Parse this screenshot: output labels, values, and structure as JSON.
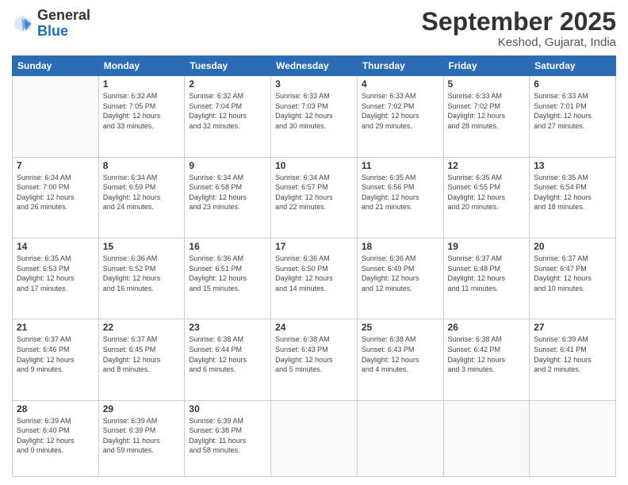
{
  "logo": {
    "general": "General",
    "blue": "Blue"
  },
  "header": {
    "month": "September 2025",
    "location": "Keshod, Gujarat, India"
  },
  "weekdays": [
    "Sunday",
    "Monday",
    "Tuesday",
    "Wednesday",
    "Thursday",
    "Friday",
    "Saturday"
  ],
  "weeks": [
    [
      {
        "day": "",
        "info": ""
      },
      {
        "day": "1",
        "info": "Sunrise: 6:32 AM\nSunset: 7:05 PM\nDaylight: 12 hours\nand 33 minutes."
      },
      {
        "day": "2",
        "info": "Sunrise: 6:32 AM\nSunset: 7:04 PM\nDaylight: 12 hours\nand 32 minutes."
      },
      {
        "day": "3",
        "info": "Sunrise: 6:33 AM\nSunset: 7:03 PM\nDaylight: 12 hours\nand 30 minutes."
      },
      {
        "day": "4",
        "info": "Sunrise: 6:33 AM\nSunset: 7:02 PM\nDaylight: 12 hours\nand 29 minutes."
      },
      {
        "day": "5",
        "info": "Sunrise: 6:33 AM\nSunset: 7:02 PM\nDaylight: 12 hours\nand 28 minutes."
      },
      {
        "day": "6",
        "info": "Sunrise: 6:33 AM\nSunset: 7:01 PM\nDaylight: 12 hours\nand 27 minutes."
      }
    ],
    [
      {
        "day": "7",
        "info": "Sunrise: 6:34 AM\nSunset: 7:00 PM\nDaylight: 12 hours\nand 26 minutes."
      },
      {
        "day": "8",
        "info": "Sunrise: 6:34 AM\nSunset: 6:59 PM\nDaylight: 12 hours\nand 24 minutes."
      },
      {
        "day": "9",
        "info": "Sunrise: 6:34 AM\nSunset: 6:58 PM\nDaylight: 12 hours\nand 23 minutes."
      },
      {
        "day": "10",
        "info": "Sunrise: 6:34 AM\nSunset: 6:57 PM\nDaylight: 12 hours\nand 22 minutes."
      },
      {
        "day": "11",
        "info": "Sunrise: 6:35 AM\nSunset: 6:56 PM\nDaylight: 12 hours\nand 21 minutes."
      },
      {
        "day": "12",
        "info": "Sunrise: 6:35 AM\nSunset: 6:55 PM\nDaylight: 12 hours\nand 20 minutes."
      },
      {
        "day": "13",
        "info": "Sunrise: 6:35 AM\nSunset: 6:54 PM\nDaylight: 12 hours\nand 18 minutes."
      }
    ],
    [
      {
        "day": "14",
        "info": "Sunrise: 6:35 AM\nSunset: 6:53 PM\nDaylight: 12 hours\nand 17 minutes."
      },
      {
        "day": "15",
        "info": "Sunrise: 6:36 AM\nSunset: 6:52 PM\nDaylight: 12 hours\nand 16 minutes."
      },
      {
        "day": "16",
        "info": "Sunrise: 6:36 AM\nSunset: 6:51 PM\nDaylight: 12 hours\nand 15 minutes."
      },
      {
        "day": "17",
        "info": "Sunrise: 6:36 AM\nSunset: 6:50 PM\nDaylight: 12 hours\nand 14 minutes."
      },
      {
        "day": "18",
        "info": "Sunrise: 6:36 AM\nSunset: 6:49 PM\nDaylight: 12 hours\nand 12 minutes."
      },
      {
        "day": "19",
        "info": "Sunrise: 6:37 AM\nSunset: 6:48 PM\nDaylight: 12 hours\nand 11 minutes."
      },
      {
        "day": "20",
        "info": "Sunrise: 6:37 AM\nSunset: 6:47 PM\nDaylight: 12 hours\nand 10 minutes."
      }
    ],
    [
      {
        "day": "21",
        "info": "Sunrise: 6:37 AM\nSunset: 6:46 PM\nDaylight: 12 hours\nand 9 minutes."
      },
      {
        "day": "22",
        "info": "Sunrise: 6:37 AM\nSunset: 6:45 PM\nDaylight: 12 hours\nand 8 minutes."
      },
      {
        "day": "23",
        "info": "Sunrise: 6:38 AM\nSunset: 6:44 PM\nDaylight: 12 hours\nand 6 minutes."
      },
      {
        "day": "24",
        "info": "Sunrise: 6:38 AM\nSunset: 6:43 PM\nDaylight: 12 hours\nand 5 minutes."
      },
      {
        "day": "25",
        "info": "Sunrise: 6:38 AM\nSunset: 6:43 PM\nDaylight: 12 hours\nand 4 minutes."
      },
      {
        "day": "26",
        "info": "Sunrise: 6:38 AM\nSunset: 6:42 PM\nDaylight: 12 hours\nand 3 minutes."
      },
      {
        "day": "27",
        "info": "Sunrise: 6:39 AM\nSunset: 6:41 PM\nDaylight: 12 hours\nand 2 minutes."
      }
    ],
    [
      {
        "day": "28",
        "info": "Sunrise: 6:39 AM\nSunset: 6:40 PM\nDaylight: 12 hours\nand 0 minutes."
      },
      {
        "day": "29",
        "info": "Sunrise: 6:39 AM\nSunset: 6:39 PM\nDaylight: 11 hours\nand 59 minutes."
      },
      {
        "day": "30",
        "info": "Sunrise: 6:39 AM\nSunset: 6:38 PM\nDaylight: 11 hours\nand 58 minutes."
      },
      {
        "day": "",
        "info": ""
      },
      {
        "day": "",
        "info": ""
      },
      {
        "day": "",
        "info": ""
      },
      {
        "day": "",
        "info": ""
      }
    ]
  ]
}
